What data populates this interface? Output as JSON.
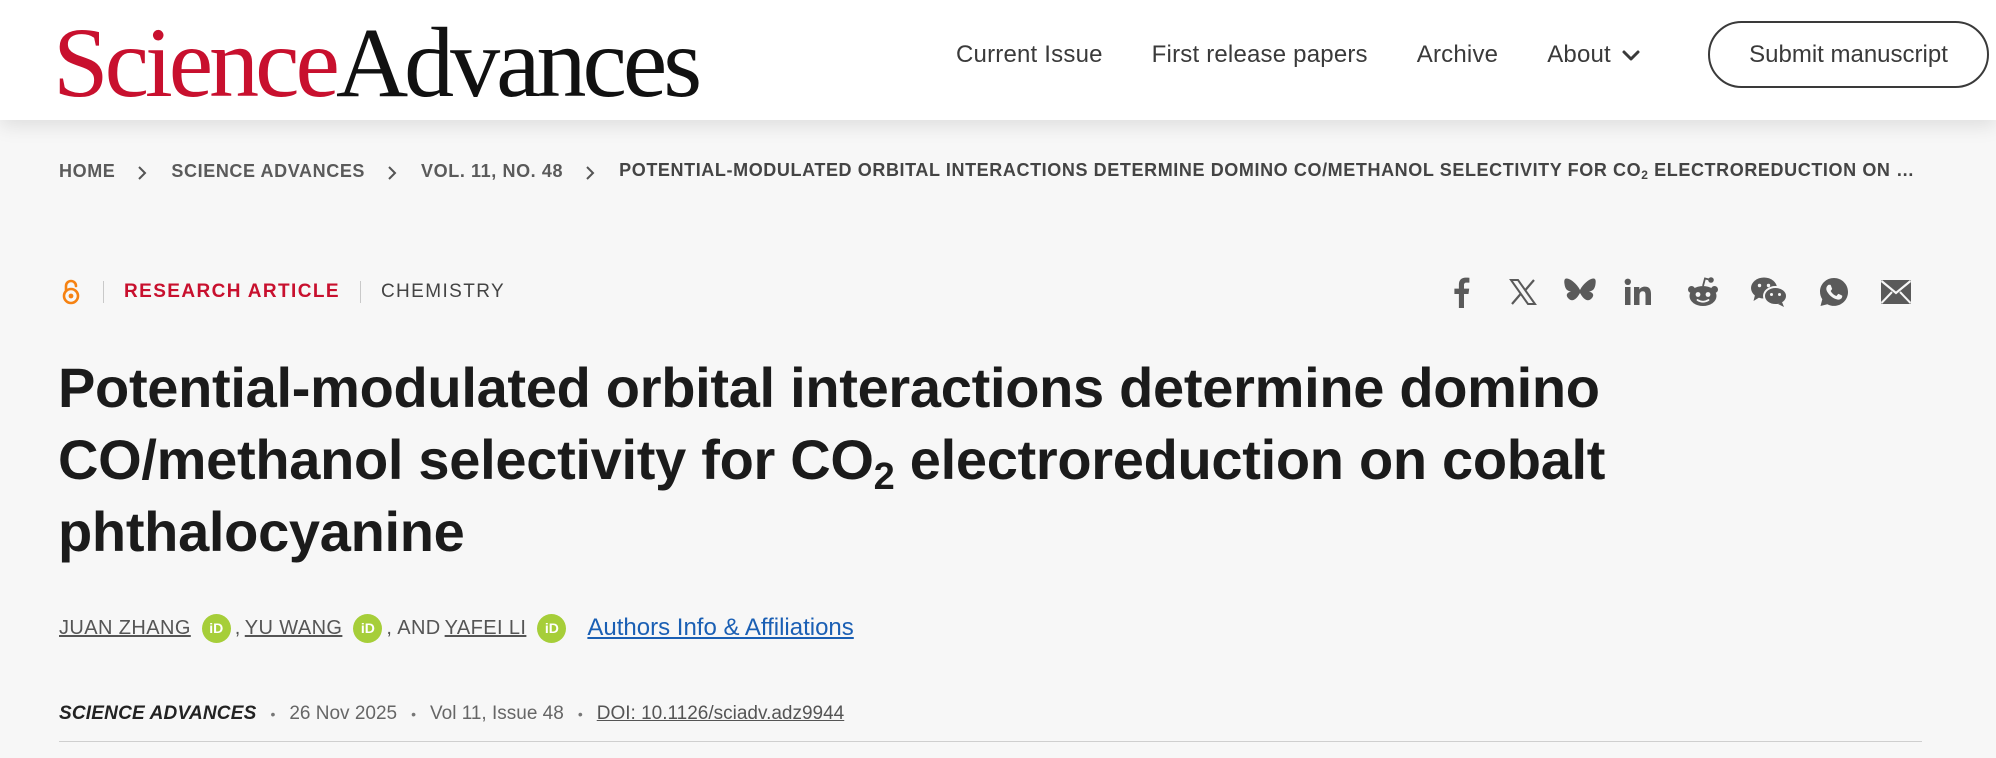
{
  "header": {
    "logo_science": "Science",
    "logo_advances": "Advances",
    "nav": [
      {
        "label": "Current Issue"
      },
      {
        "label": "First release papers"
      },
      {
        "label": "Archive"
      },
      {
        "label": "About",
        "icon": "chevron-down-icon"
      }
    ],
    "submit_label": "Submit manuscript"
  },
  "breadcrumb": {
    "items": [
      "HOME",
      "SCIENCE ADVANCES",
      "VOL. 11, NO. 48"
    ],
    "current_prefix": "POTENTIAL-MODULATED ORBITAL INTERACTIONS DETERMINE DOMINO CO/METHANOL SELECTIVITY FOR CO",
    "current_sub": "2",
    "current_suffix": " ELECTROREDUCTION ON COBALT PHTHALOCYANINE"
  },
  "article": {
    "access_icon": "open-access-icon",
    "type": "RESEARCH ARTICLE",
    "subject": "CHEMISTRY",
    "title_part1": "Potential-modulated orbital interactions determine domino CO/methanol selectivity for CO",
    "title_sub": "2",
    "title_part2": " electroreduction on cobalt phthalocyanine",
    "authors": [
      {
        "name": "JUAN ZHANG",
        "orcid": "iD"
      },
      {
        "name": "YU WANG",
        "orcid": "iD"
      },
      {
        "name": "YAFEI LI",
        "orcid": "iD"
      }
    ],
    "author_sep_1": ",",
    "author_sep_2": ", AND",
    "affiliations_label": "Authors Info & Affiliations",
    "journal": "SCIENCE ADVANCES",
    "date": "26 Nov 2025",
    "volume": "Vol 11, Issue 48",
    "doi": "DOI: 10.1126/sciadv.adz9944"
  },
  "share": {
    "icons": [
      "facebook-icon",
      "x-icon",
      "bluesky-icon",
      "linkedin-icon",
      "reddit-icon",
      "wechat-icon",
      "whatsapp-icon",
      "email-icon"
    ],
    "color": "#5a5a5a"
  },
  "colors": {
    "brand_red": "#c8102e",
    "link_blue": "#1a5fb4",
    "orcid_green": "#a6ce39",
    "open_access_orange": "#f68212"
  }
}
